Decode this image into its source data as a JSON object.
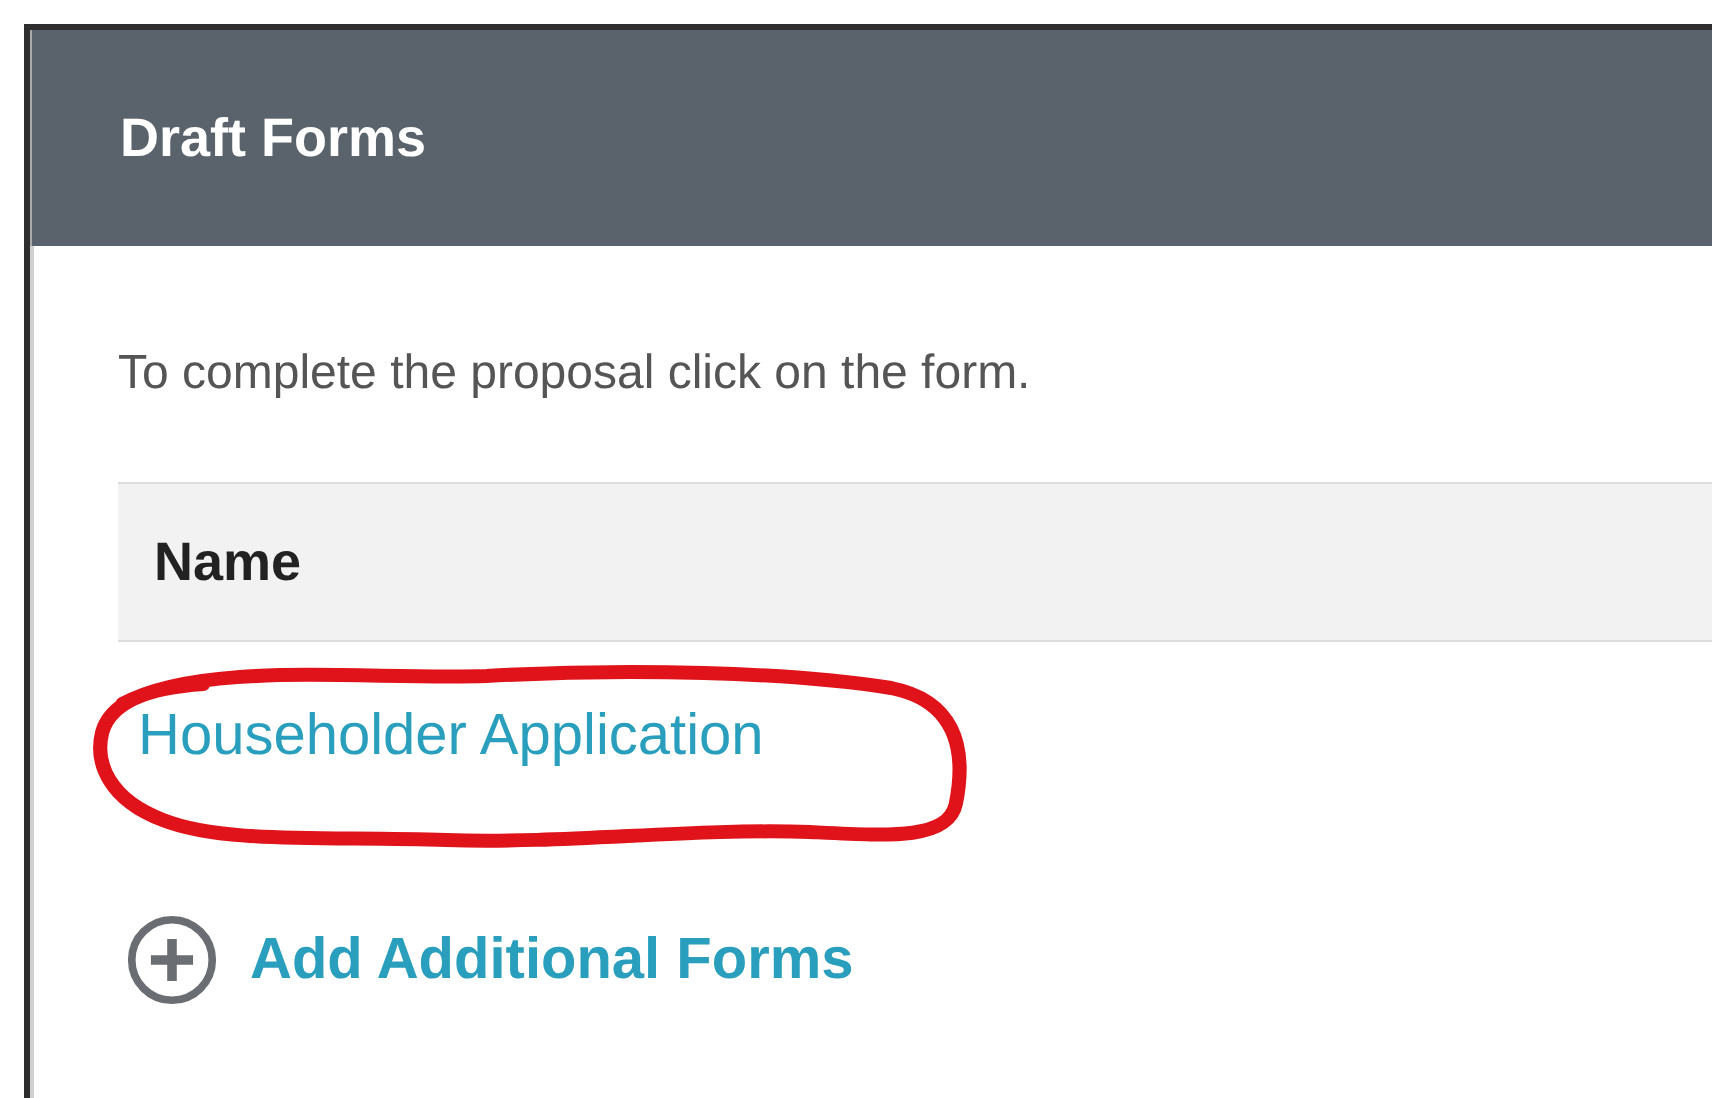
{
  "panel": {
    "title": "Draft Forms"
  },
  "instructions": "To complete the proposal click on the form.",
  "table": {
    "columns": [
      "Name"
    ],
    "rows": [
      {
        "name": "Householder Application"
      }
    ]
  },
  "add_link": "Add Additional Forms"
}
